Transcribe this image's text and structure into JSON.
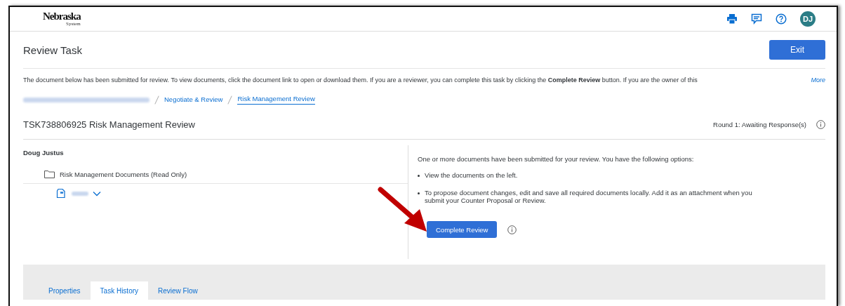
{
  "header": {
    "logo": {
      "name": "Nebraska",
      "sub": "System"
    },
    "avatar": "DJ"
  },
  "page": {
    "title": "Review Task",
    "exit_button": "Exit",
    "description": "The document below has been submitted for review. To view documents, click the document link to open or download them.  If you are a reviewer, you can complete this task by clicking the **Complete Review** button. If you are the owner of this",
    "more_link": "More"
  },
  "breadcrumbs": [
    {
      "label": "Negotiate & Review",
      "selected": false
    },
    {
      "label": "Risk Management Review",
      "selected": true
    }
  ],
  "task": {
    "title": "TSK738806925 Risk Management Review",
    "status": "Round 1: Awaiting Response(s)"
  },
  "left_pane": {
    "reviewer": "Doug Justus",
    "folder": "Risk Management Documents (Read Only)"
  },
  "right_pane": {
    "intro": "One or more documents have been submitted for your review. You have the following options:",
    "bullets": [
      "View the documents on the left.",
      "To propose document changes, edit and save all required documents locally. Add it as an attachment when you submit your Counter Proposal or Review."
    ],
    "complete_button": "Complete Review"
  },
  "tabs": [
    {
      "label": "Properties",
      "selected": false
    },
    {
      "label": "Task History",
      "selected": true
    },
    {
      "label": "Review Flow",
      "selected": false
    }
  ]
}
